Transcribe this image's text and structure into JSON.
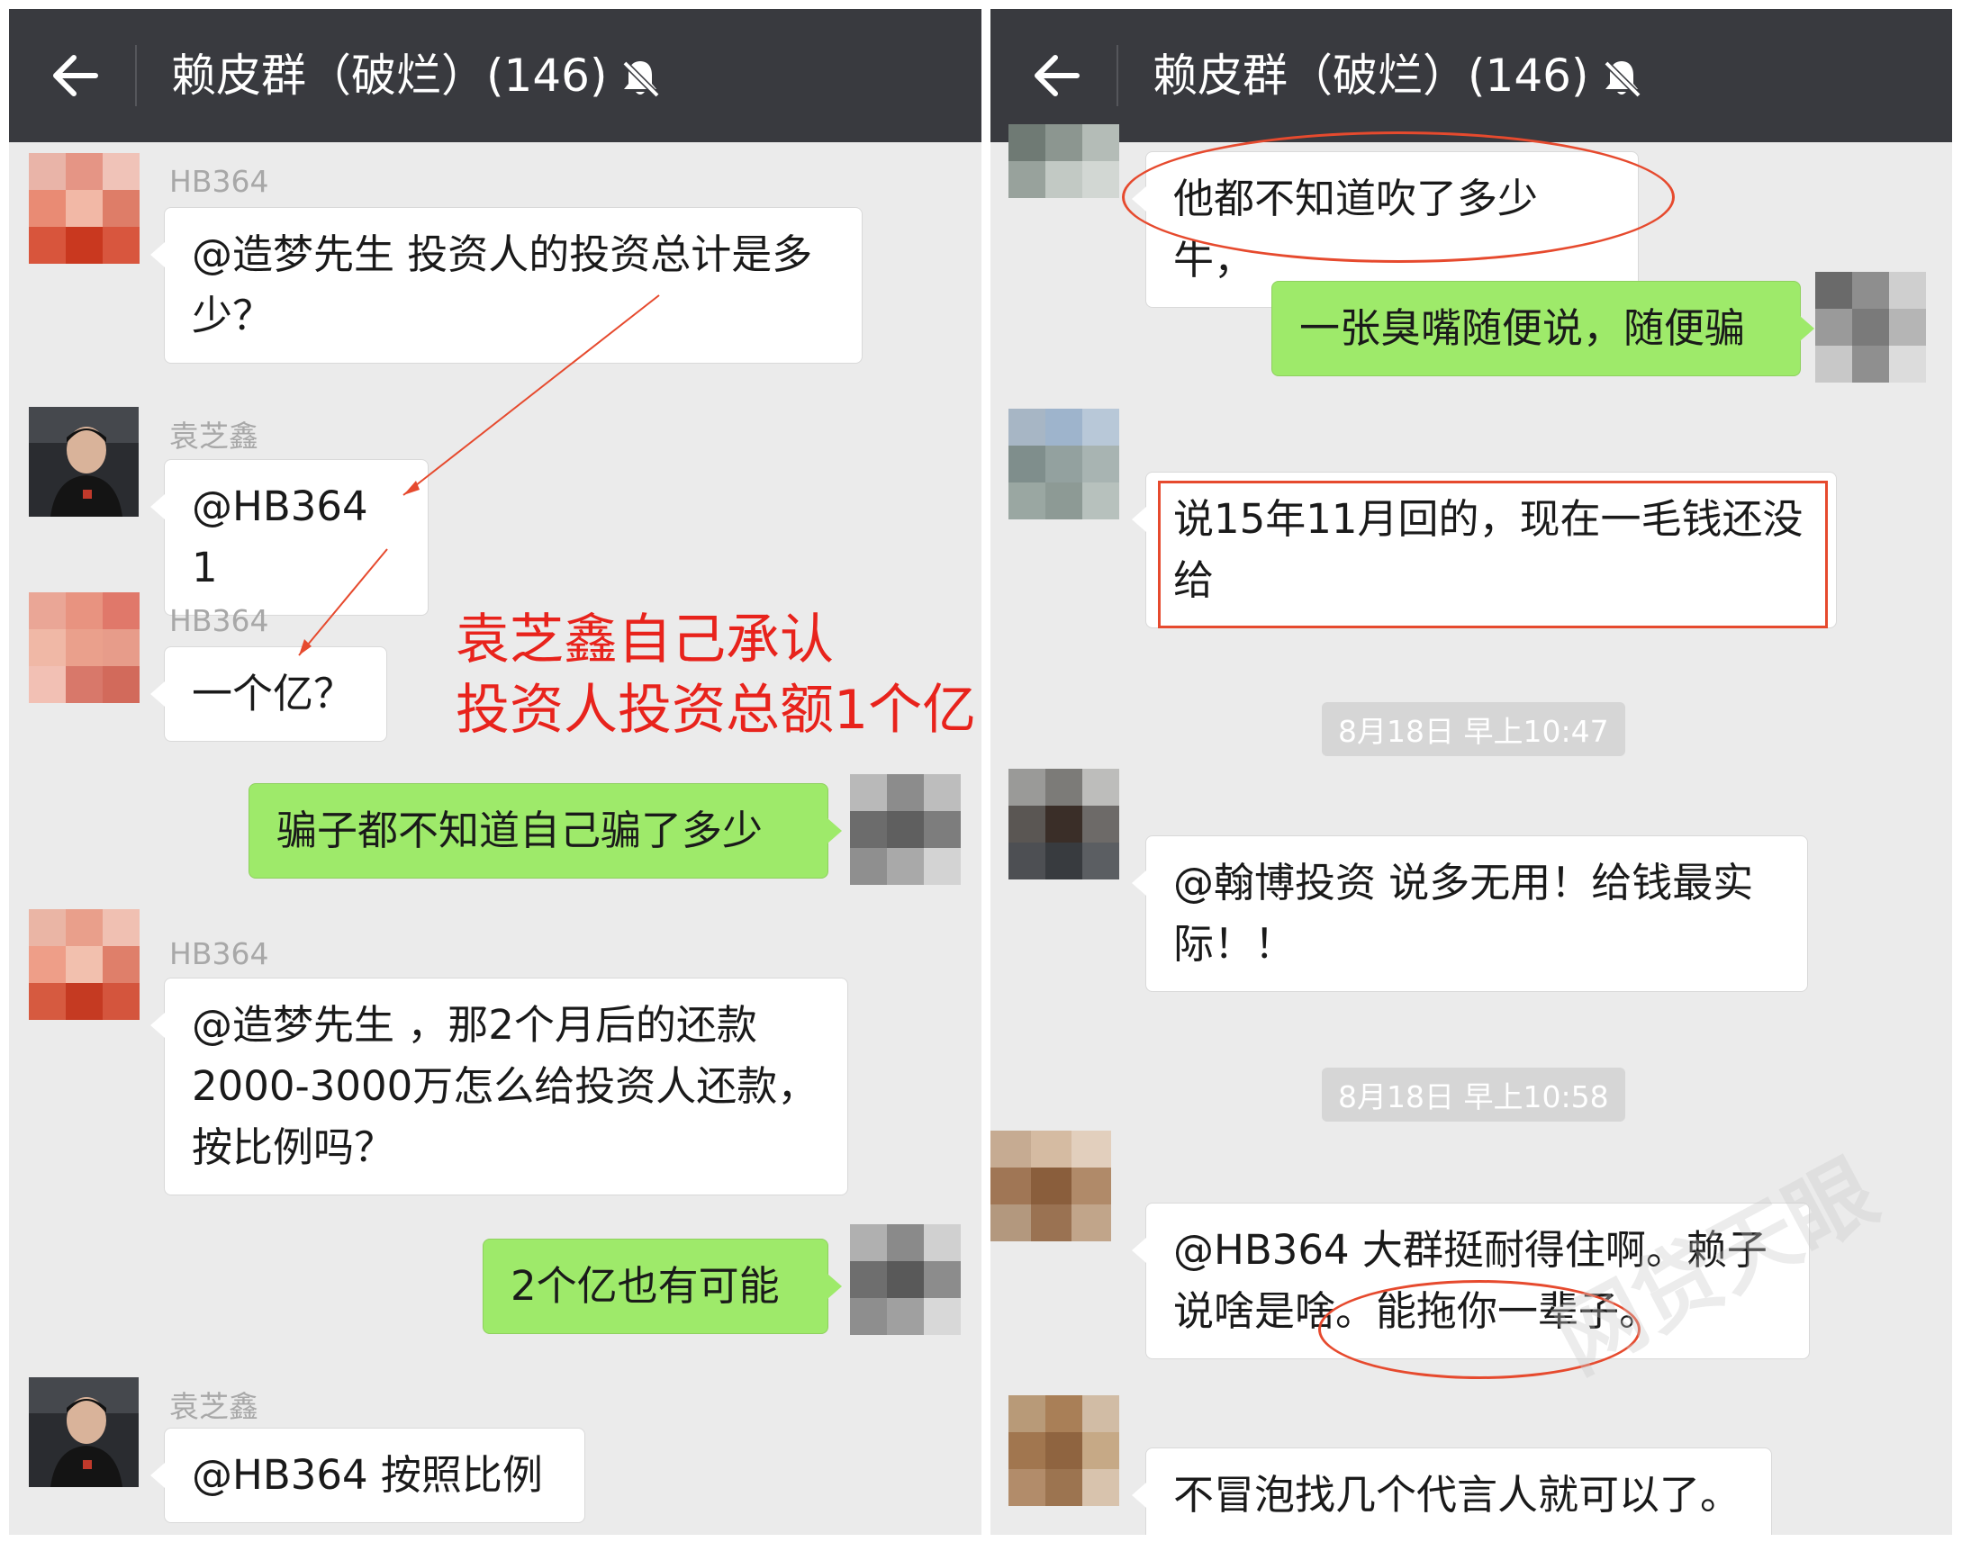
{
  "left_screen": {
    "header": {
      "title": "赖皮群（破烂）(146)"
    },
    "messages": [
      {
        "sender": "HB364",
        "text": "@造梦先生 投资人的投资总计是多少？"
      },
      {
        "sender": "袁芝鑫",
        "text": "@HB364 1"
      },
      {
        "sender": "HB364",
        "text": "一个亿？"
      },
      {
        "text": "骗子都不知道自己骗了多少"
      },
      {
        "sender": "HB364",
        "text": "@造梦先生 ，那2个月后的还款2000-3000万怎么给投资人还款，按比例吗？"
      },
      {
        "text": "2个亿也有可能"
      },
      {
        "sender": "袁芝鑫",
        "text": "@HB364 按照比例"
      }
    ],
    "annotation": {
      "line1": "袁芝鑫自己承认",
      "line2": "投资人投资总额1个亿"
    }
  },
  "right_screen": {
    "header": {
      "title": "赖皮群（破烂）(146)"
    },
    "messages": [
      {
        "text": "他都不知道吹了多少牛，"
      },
      {
        "text": "一张臭嘴随便说，随便骗"
      },
      {
        "text": "说15年11月回的，现在一毛钱还没给"
      },
      {
        "text": "@翰博投资 说多无用！给钱最实际！！"
      },
      {
        "text": "@HB364 大群挺耐得住啊。赖子说啥是啥。能拖你一辈子。"
      },
      {
        "text": "不冒泡找几个代言人就可以了。"
      }
    ],
    "timestamps": [
      "8月18日 早上10:47",
      "8月18日 早上10:58"
    ]
  },
  "watermark": "网贷天眼",
  "colors": {
    "header_bg": "#393a3f",
    "chat_bg": "#ebebeb",
    "green_bubble": "#9eea6a",
    "annotation_red": "#e8231c",
    "timestamp_bg": "#d6d6d6"
  },
  "icons": {
    "back": "back-arrow-icon",
    "mute": "bell-mute-icon"
  }
}
